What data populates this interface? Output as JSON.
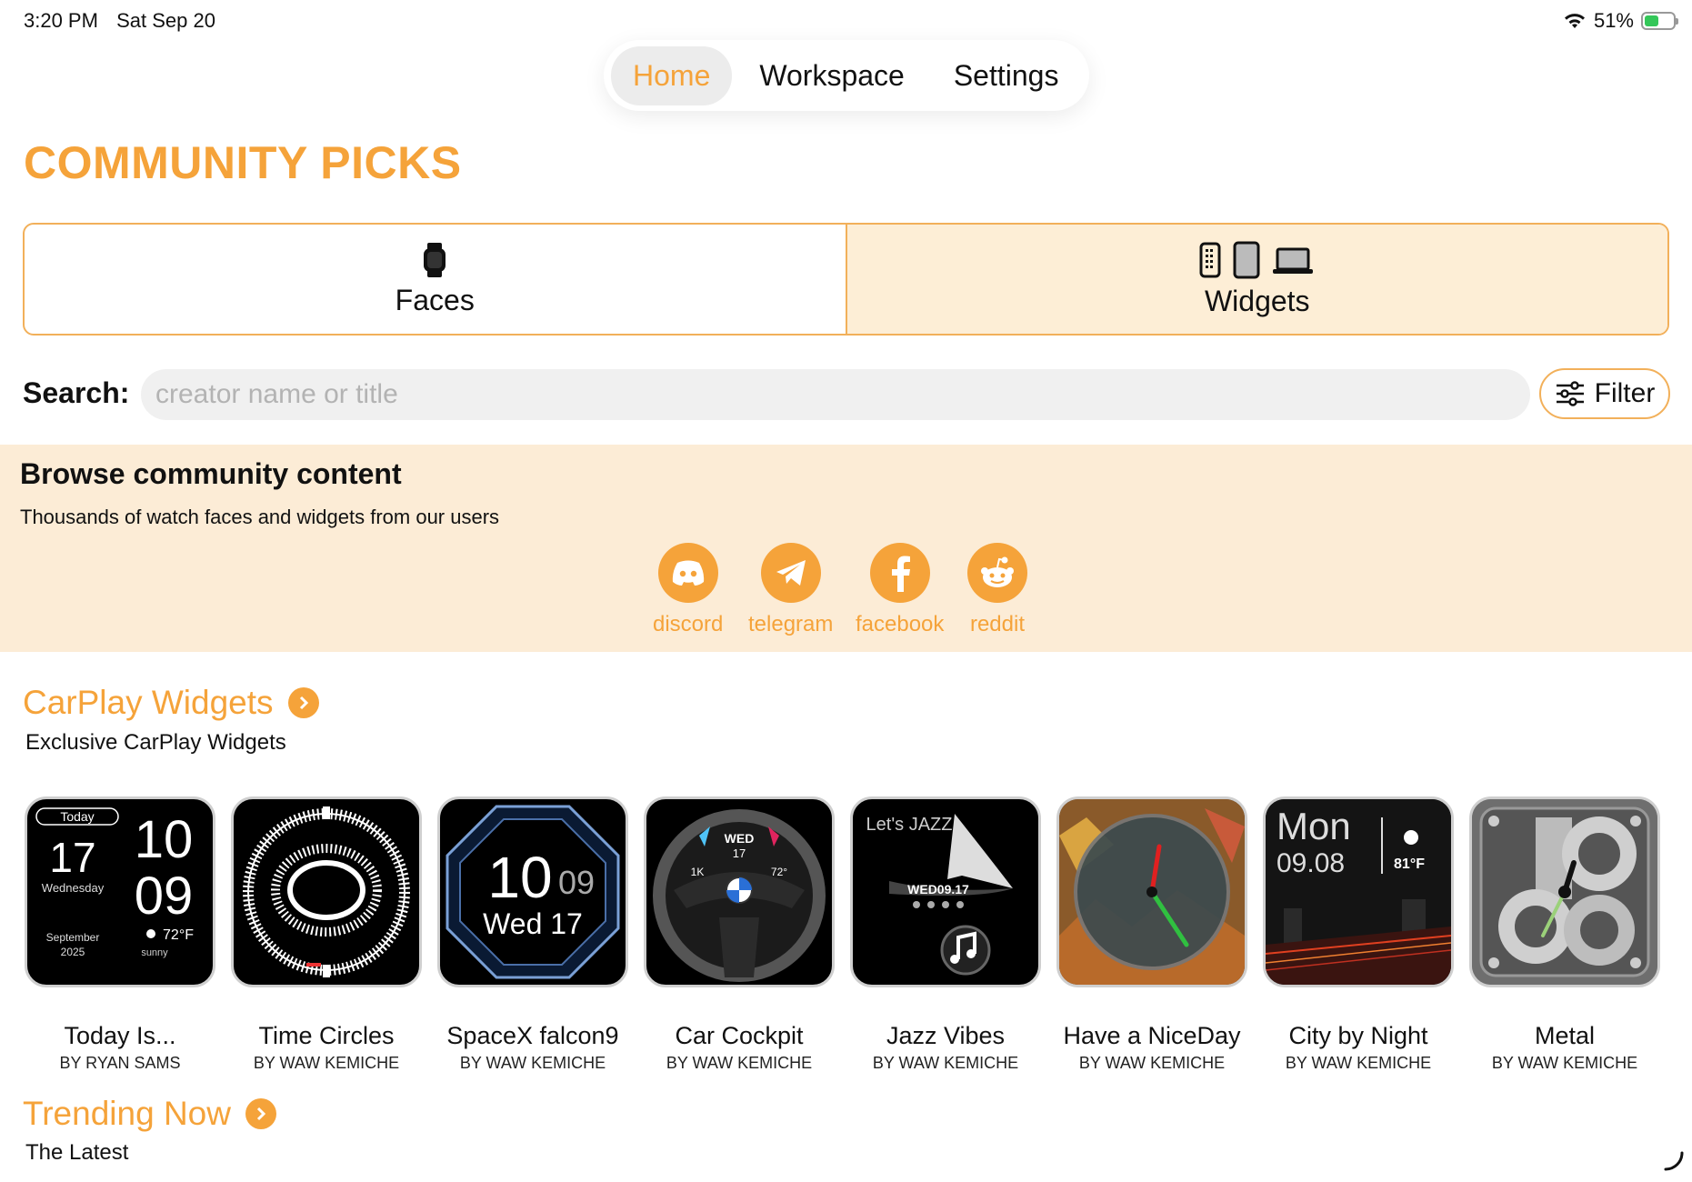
{
  "status_bar": {
    "time": "3:20 PM",
    "date": "Sat Sep 20",
    "battery": "51%",
    "battery_level": 0.51
  },
  "nav": {
    "tabs": [
      "Home",
      "Workspace",
      "Settings"
    ],
    "active": "Home"
  },
  "page_title": "COMMUNITY PICKS",
  "segments": [
    {
      "label": "Faces",
      "icon": "watch-icon",
      "selected": false
    },
    {
      "label": "Widgets",
      "icon": "devices-icon",
      "selected": true
    }
  ],
  "search": {
    "label": "Search:",
    "placeholder": "creator name or title",
    "value": "",
    "filter_label": "Filter"
  },
  "banner": {
    "title": "Browse community content",
    "subtitle": "Thousands of watch faces and widgets from our users",
    "socials": [
      {
        "label": "discord",
        "icon": "discord-icon"
      },
      {
        "label": "telegram",
        "icon": "telegram-icon"
      },
      {
        "label": "facebook",
        "icon": "facebook-icon"
      },
      {
        "label": "reddit",
        "icon": "reddit-icon"
      }
    ]
  },
  "carplay": {
    "title": "CarPlay Widgets",
    "subtitle": "Exclusive CarPlay Widgets",
    "items": [
      {
        "title": "Today Is...",
        "by": "BY RYAN SAMS",
        "thumb": {
          "today": "Today",
          "day": "17",
          "weekday": "Wednesday",
          "month": "September",
          "year": "2025",
          "hour": "10",
          "minute": "09",
          "temp": "72°F",
          "cond": "sunny"
        }
      },
      {
        "title": "Time Circles",
        "by": "BY WAW KEMICHE"
      },
      {
        "title": "SpaceX falcon9",
        "by": "BY WAW KEMICHE",
        "thumb": {
          "hour": "10",
          "minute": "09",
          "date": "Wed 17"
        }
      },
      {
        "title": "Car Cockpit",
        "by": "BY WAW KEMICHE",
        "thumb": {
          "day": "WED",
          "date": "17",
          "left": "1K",
          "right": "72°"
        }
      },
      {
        "title": "Jazz Vibes",
        "by": "BY WAW KEMICHE",
        "thumb": {
          "logo": "Let's JAZZ",
          "date": "WED09.17"
        }
      },
      {
        "title": "Have a NiceDay",
        "by": "BY WAW KEMICHE"
      },
      {
        "title": "City by Night",
        "by": "BY WAW KEMICHE",
        "thumb": {
          "day": "Mon",
          "time": "09.08",
          "temp": "81°F"
        }
      },
      {
        "title": "Metal",
        "by": "BY WAW KEMICHE"
      }
    ]
  },
  "trending": {
    "title": "Trending Now",
    "subtitle": "The Latest"
  },
  "colors": {
    "accent": "#f5a33a",
    "banner_bg": "#fcecd6",
    "selected_bg": "#fdeed6",
    "battery": "#34c759"
  }
}
